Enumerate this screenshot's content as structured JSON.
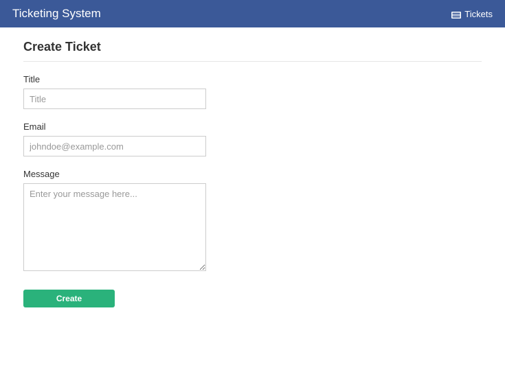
{
  "navbar": {
    "brand": "Ticketing System",
    "tickets_link": "Tickets"
  },
  "page": {
    "title": "Create Ticket"
  },
  "form": {
    "title": {
      "label": "Title",
      "placeholder": "Title",
      "value": ""
    },
    "email": {
      "label": "Email",
      "placeholder": "johndoe@example.com",
      "value": ""
    },
    "message": {
      "label": "Message",
      "placeholder": "Enter your message here...",
      "value": ""
    },
    "submit_label": "Create"
  }
}
